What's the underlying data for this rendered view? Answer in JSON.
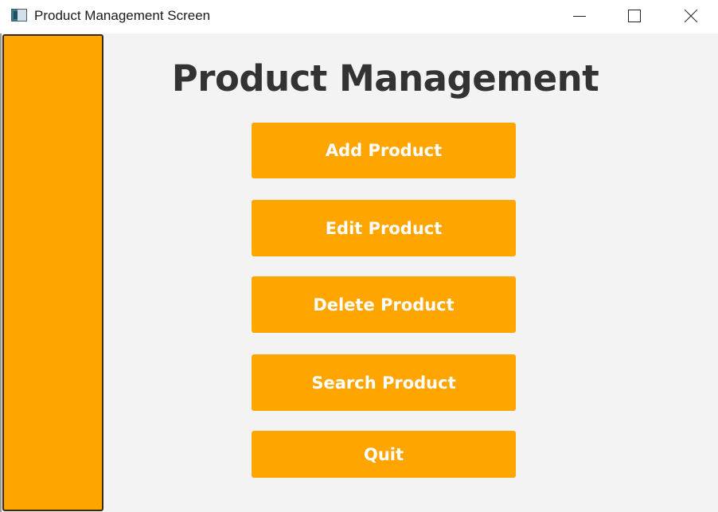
{
  "window": {
    "title": "Product Management Screen"
  },
  "main": {
    "heading": "Product Management",
    "buttons": {
      "add": "Add Product",
      "edit": "Edit Product",
      "delete": "Delete Product",
      "search": "Search Product",
      "quit": "Quit"
    }
  },
  "colors": {
    "accent": "#ffa500",
    "background": "#f3f3f3",
    "heading_text": "#333333",
    "button_text": "#ffffff"
  },
  "icons": {
    "app": "app-window-icon",
    "minimize": "minimize-icon",
    "maximize": "maximize-icon",
    "close": "close-icon"
  }
}
